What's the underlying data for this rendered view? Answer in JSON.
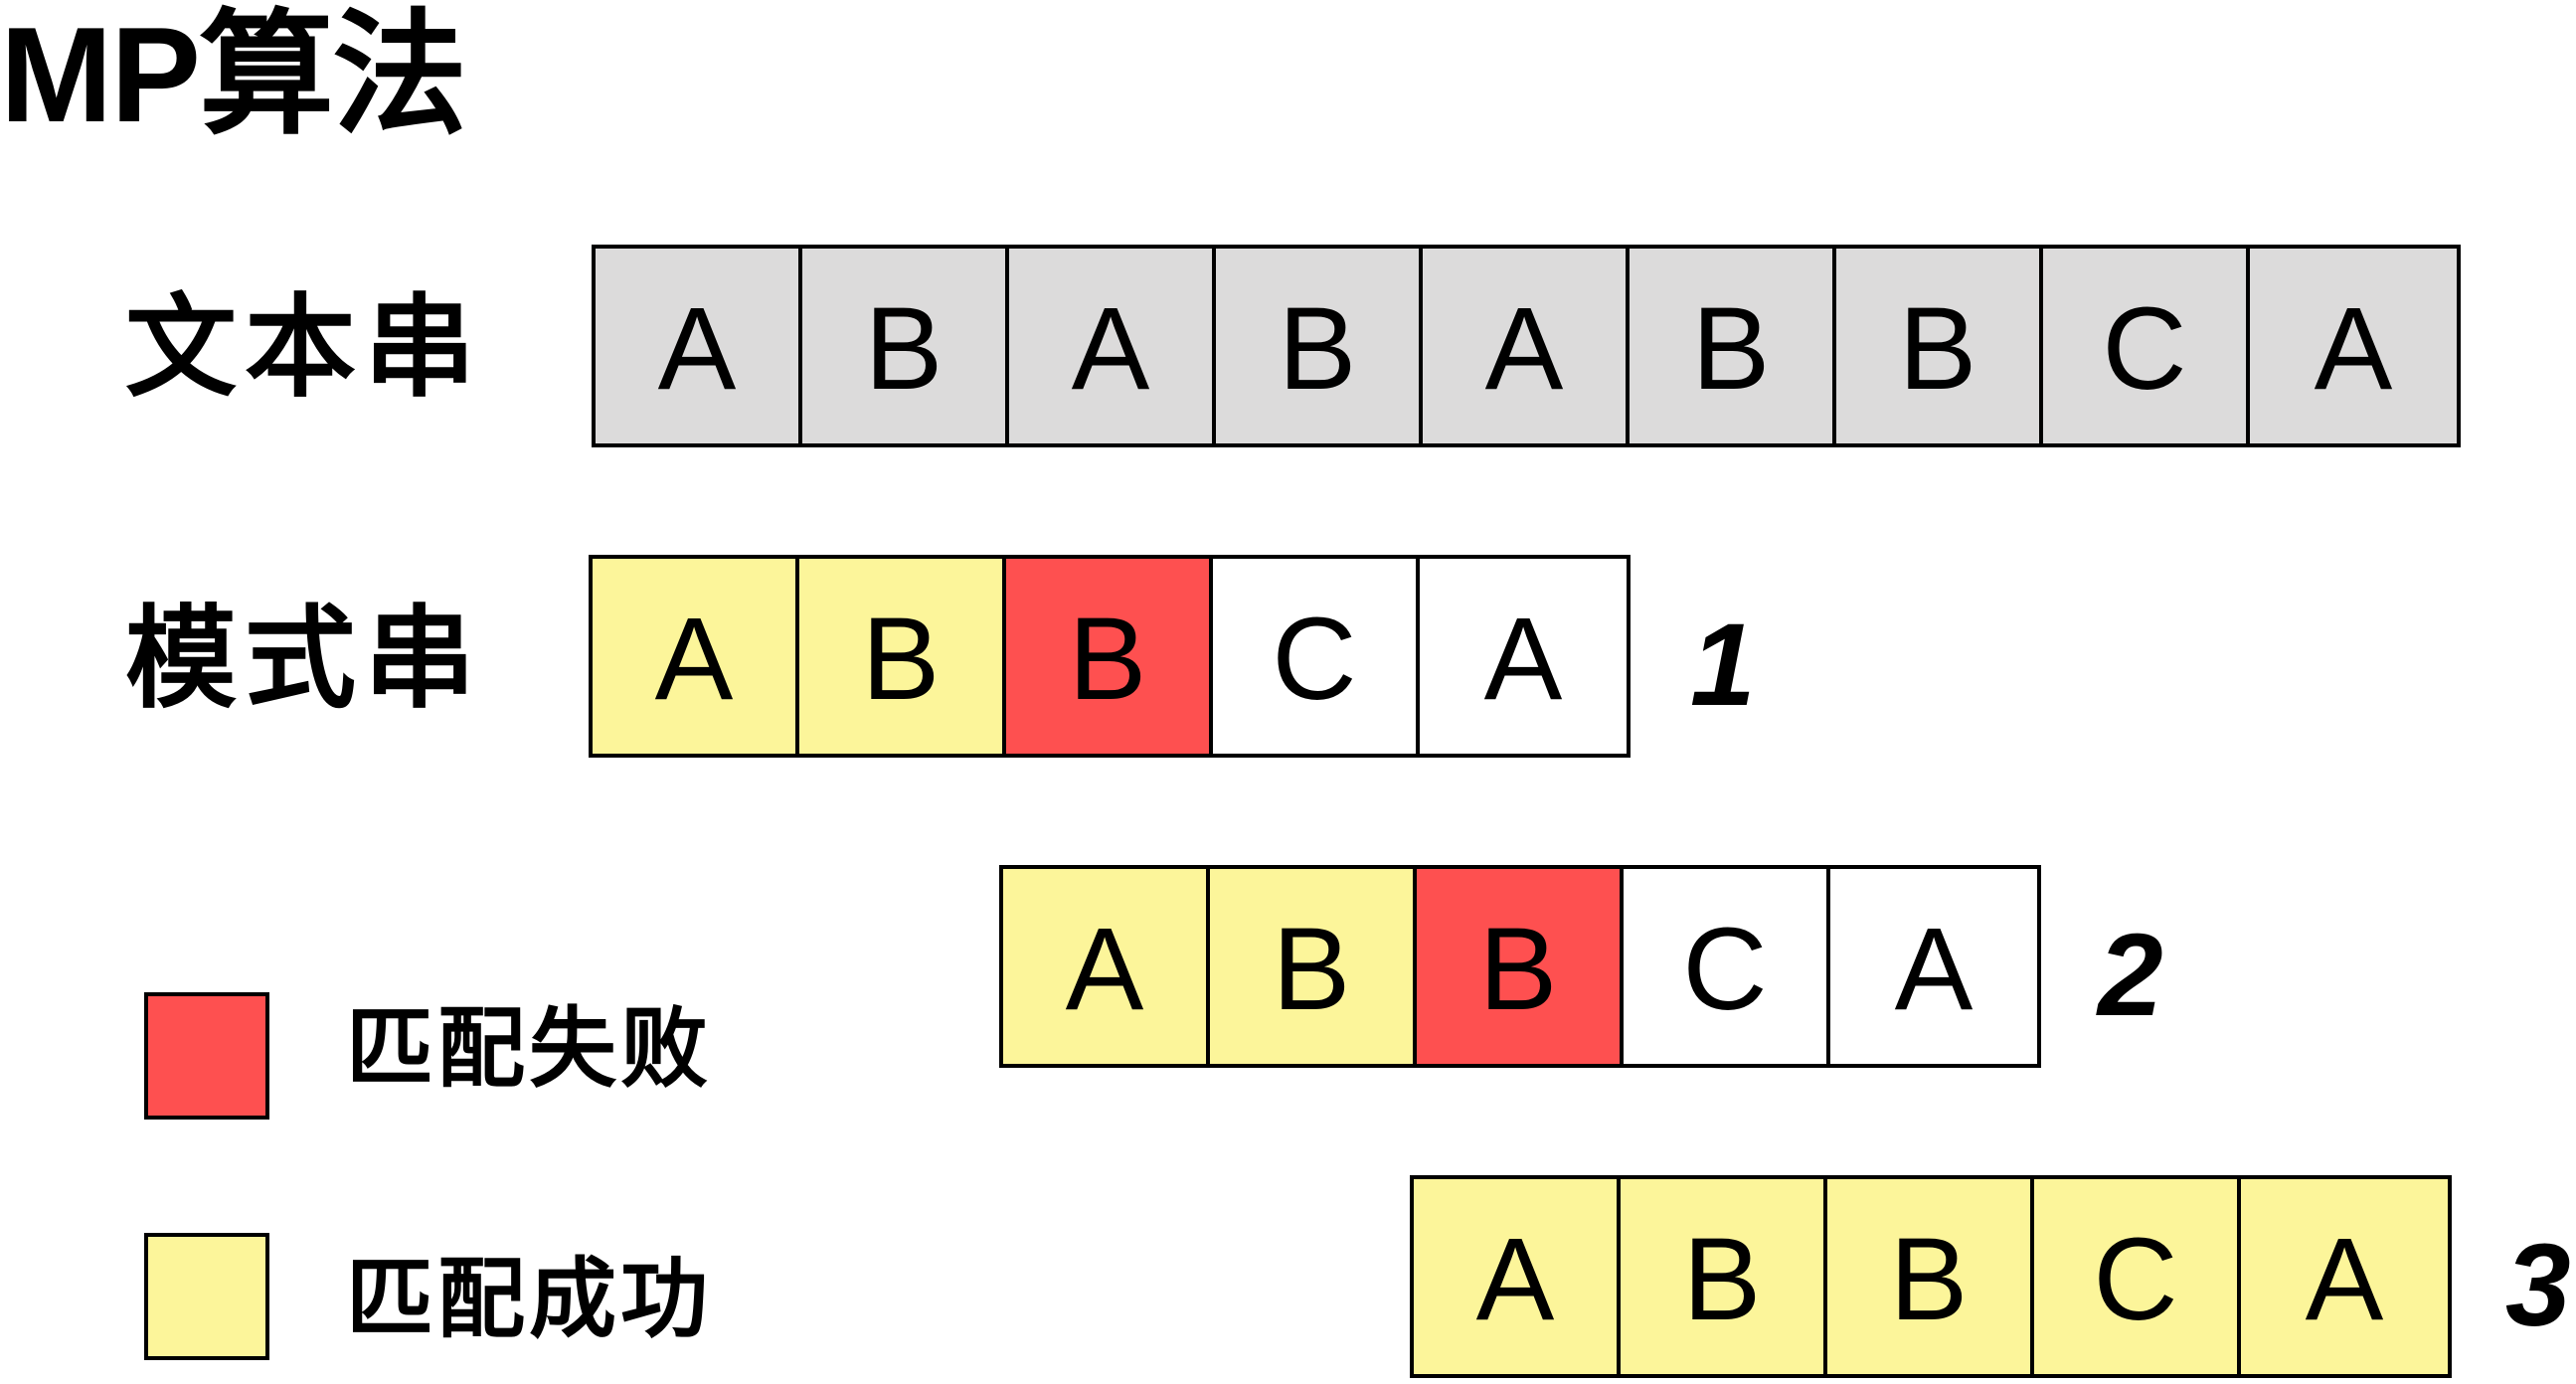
{
  "title": "MP算法",
  "labels": {
    "text_string": "文本串",
    "pattern_string": "模式串"
  },
  "text_cells": [
    "A",
    "B",
    "A",
    "B",
    "A",
    "B",
    "B",
    "C",
    "A"
  ],
  "attempts": [
    {
      "step": "1",
      "cells": [
        {
          "char": "A",
          "state": "match"
        },
        {
          "char": "B",
          "state": "match"
        },
        {
          "char": "B",
          "state": "fail"
        },
        {
          "char": "C",
          "state": "none"
        },
        {
          "char": "A",
          "state": "none"
        }
      ]
    },
    {
      "step": "2",
      "cells": [
        {
          "char": "A",
          "state": "match"
        },
        {
          "char": "B",
          "state": "match"
        },
        {
          "char": "B",
          "state": "fail"
        },
        {
          "char": "C",
          "state": "none"
        },
        {
          "char": "A",
          "state": "none"
        }
      ]
    },
    {
      "step": "3",
      "cells": [
        {
          "char": "A",
          "state": "match"
        },
        {
          "char": "B",
          "state": "match"
        },
        {
          "char": "B",
          "state": "match"
        },
        {
          "char": "C",
          "state": "match"
        },
        {
          "char": "A",
          "state": "match"
        }
      ]
    }
  ],
  "legend": [
    {
      "label": "匹配失败",
      "color": "#fe5050"
    },
    {
      "label": "匹配成功",
      "color": "#fcf59a"
    }
  ],
  "colors": {
    "text_cell": "#dcdbdb",
    "match": "#fcf59a",
    "fail": "#fe5050",
    "none": "#ffffff"
  }
}
